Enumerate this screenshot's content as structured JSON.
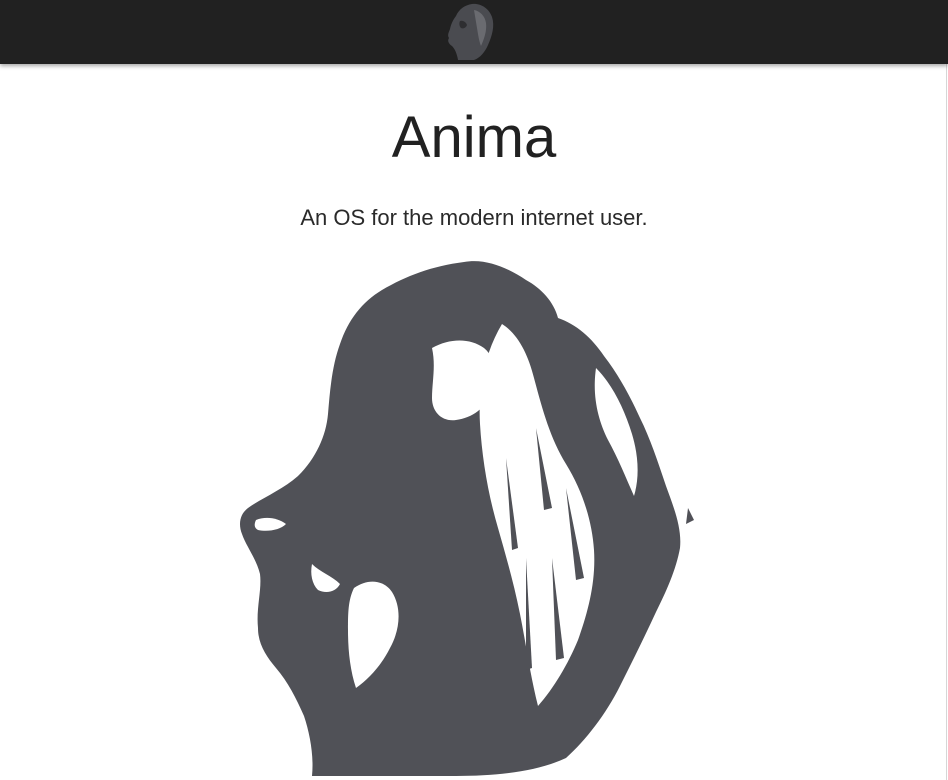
{
  "header": {
    "logo_icon": "lion-head-icon",
    "background": "#212121"
  },
  "hero": {
    "title": "Anima",
    "subtitle": "An OS for the modern internet user.",
    "illustration_icon": "lion-head-illustration",
    "illustration_color": "#505157"
  }
}
